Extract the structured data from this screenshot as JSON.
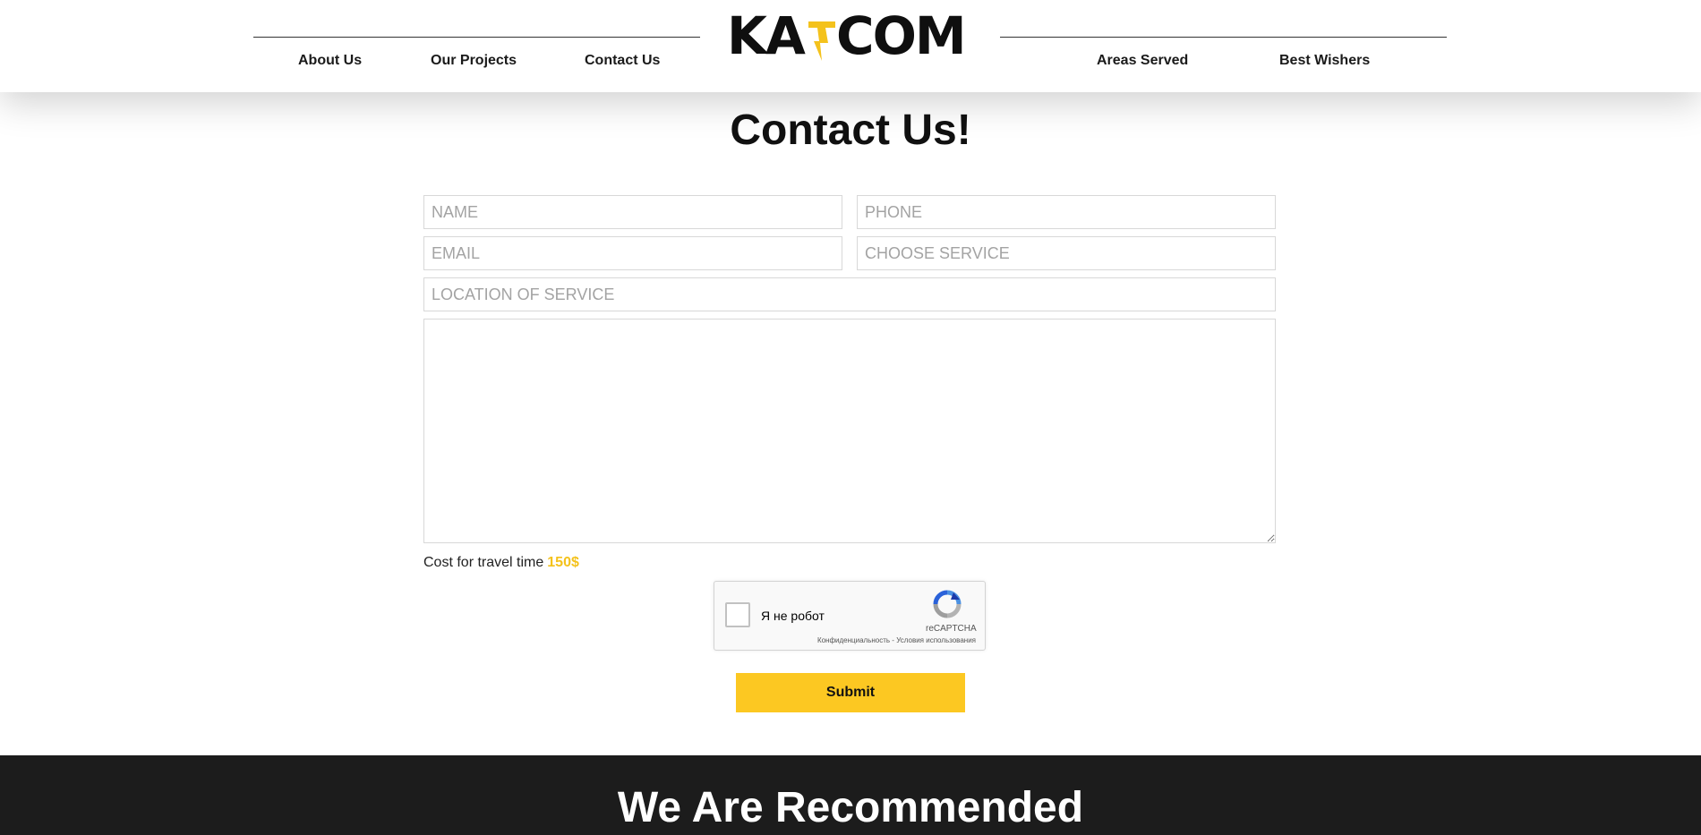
{
  "header": {
    "logo_text": "KATCOM",
    "logo_left": "KA",
    "logo_right": "COM",
    "nav_left": [
      "About Us",
      "Our Projects",
      "Contact Us"
    ],
    "nav_right": [
      "Areas Served",
      "Best Wishers"
    ]
  },
  "page": {
    "title": "Contact Us!"
  },
  "form": {
    "name_placeholder": "NAME",
    "phone_placeholder": "PHONE",
    "email_placeholder": "EMAIL",
    "service_placeholder": "CHOOSE SERVICE",
    "location_placeholder": "LOCATION OF SERVICE",
    "message_value": "",
    "cost_label": "Cost for travel time",
    "cost_amount": "150$",
    "submit_label": "Submit"
  },
  "recaptcha": {
    "label": "Я не робот",
    "brand": "reCAPTCHA",
    "links": "Конфиденциальность - Условия использования"
  },
  "footer_band": {
    "title": "We Are Recommended"
  },
  "colors": {
    "accent": "#fcc822",
    "dark": "#1c1c1c"
  },
  "icons": {
    "logo_bolt": "lightning-bolt-icon",
    "recaptcha": "recaptcha-icon"
  }
}
